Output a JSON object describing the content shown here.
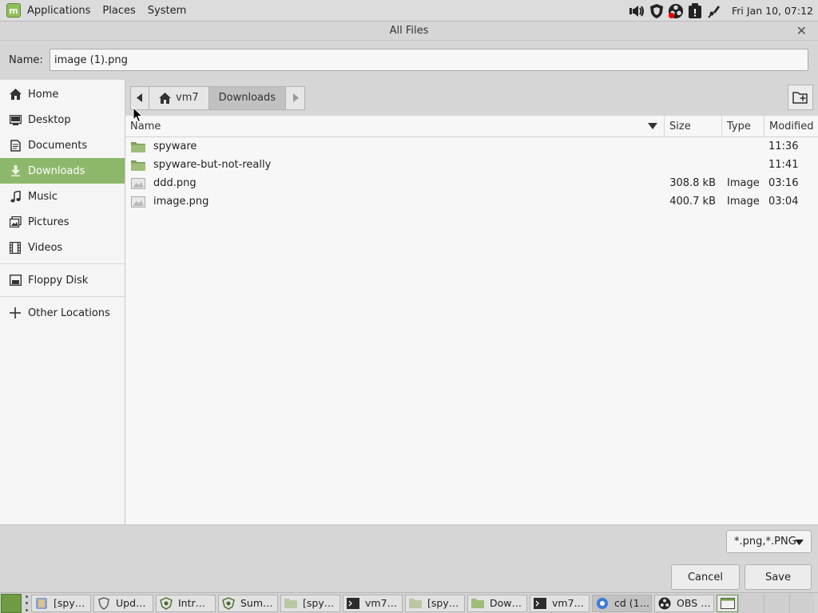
{
  "top_panel": {
    "menus": [
      "Applications",
      "Places",
      "System"
    ],
    "clock": "Fri Jan 10, 07:12",
    "tray_icons": [
      "volume-icon",
      "shield-icon",
      "obs-record-icon",
      "update-icon",
      "network-icon"
    ]
  },
  "dialog": {
    "title": "All Files",
    "name_label": "Name:",
    "name_value": "image (1).png",
    "sidebar": [
      {
        "label": "Home",
        "icon": "home-icon"
      },
      {
        "label": "Desktop",
        "icon": "desktop-icon"
      },
      {
        "label": "Documents",
        "icon": "documents-icon"
      },
      {
        "label": "Downloads",
        "icon": "download-icon",
        "active": true
      },
      {
        "label": "Music",
        "icon": "music-icon"
      },
      {
        "label": "Pictures",
        "icon": "pictures-icon"
      },
      {
        "label": "Videos",
        "icon": "videos-icon"
      },
      {
        "label": "Floppy Disk",
        "icon": "floppy-icon"
      },
      {
        "label": "Other Locations",
        "icon": "plus-icon"
      }
    ],
    "pathbar": {
      "segments": [
        "vm7",
        "Downloads"
      ],
      "current": "Downloads"
    },
    "columns": {
      "name": "Name",
      "size": "Size",
      "type": "Type",
      "modified": "Modified"
    },
    "files": [
      {
        "name": "spyware",
        "kind": "folder",
        "size": "",
        "type": "",
        "modified": "11:36"
      },
      {
        "name": "spyware-but-not-really",
        "kind": "folder",
        "size": "",
        "type": "",
        "modified": "11:41"
      },
      {
        "name": "ddd.png",
        "kind": "image",
        "size": "308.8 kB",
        "type": "Image",
        "modified": "03:16"
      },
      {
        "name": "image.png",
        "kind": "image",
        "size": "400.7 kB",
        "type": "Image",
        "modified": "03:04"
      }
    ],
    "filter": "*.png,*.PNG",
    "buttons": {
      "cancel": "Cancel",
      "save": "Save"
    }
  },
  "taskbar": {
    "tasks": [
      {
        "label": "[spy…",
        "icon": "files-icon"
      },
      {
        "label": "Upd…",
        "icon": "shield-icon"
      },
      {
        "label": "Intr…",
        "icon": "mint-icon"
      },
      {
        "label": "Sum…",
        "icon": "mint-icon"
      },
      {
        "label": "[spy…",
        "icon": "folder-icon"
      },
      {
        "label": "vm7…",
        "icon": "terminal-icon"
      },
      {
        "label": "[spy…",
        "icon": "folder-icon"
      },
      {
        "label": "Dow…",
        "icon": "folder-icon"
      },
      {
        "label": "vm7…",
        "icon": "terminal-icon"
      },
      {
        "label": "cd (1…",
        "icon": "browser-icon",
        "active": true
      },
      {
        "label": "OBS …",
        "icon": "obs-icon"
      }
    ]
  },
  "colors": {
    "accent_green": "#8db86b",
    "panel_gray": "#dcdcdc",
    "sidebar_bg": "#f5f5f5"
  }
}
